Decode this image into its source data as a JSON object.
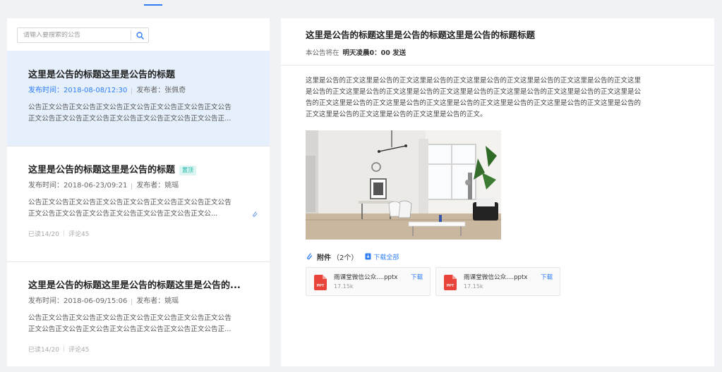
{
  "search": {
    "placeholder": "请输入要搜索的公告"
  },
  "list": [
    {
      "title": "这里是公告的标题这里是公告的标题",
      "date": "发布时间：2018-08-08/12:30",
      "author": "发布者：张佩奇",
      "body": [
        "公告正文公告正文公告正文公告正文公告正文公告正文公告正文公告",
        "正文公告正文公告正文公告正文公告正文公告正文公告正文公告正..."
      ],
      "status": "unread-selected"
    },
    {
      "title": "这里是公告的标题这里是公告的标题",
      "badge": "置顶",
      "date": "发布时间：2018-06-23/09:21",
      "author": "发布者：姚瑶",
      "body": [
        "公告正文公告正文公告正文公告正文公告正文公告正文公告正文公告",
        "正文公告正文公告正文公告正文公告正文公告正文公告正文公..."
      ],
      "read": "已读14/20",
      "comments": "评论45",
      "status": "unread"
    },
    {
      "title": "这里是公告的标题这里是公告的标题这里是公告的...",
      "date": "发布时间：2018-06-09/15:06",
      "author": "发布者：姚瑶",
      "body": [
        "公告正文公告正文公告正文公告正文公告正文公告正文公告正文公告",
        "正文公告正文公告正文公告正文公告正文公告正文公告正文公告正..."
      ],
      "read": "已读14/20",
      "comments": "评论45",
      "status": "unread"
    }
  ],
  "detail": {
    "title": "这里是公告的标题这里是公告的标题这里是公告的标题标题",
    "schedule_prefix": "本公告将在",
    "schedule_time": "明天凌晨0：00 发送",
    "body_lines": [
      "这里是公告的正文这里是公告的正文这里是公告的正文这里是公告的正文这里是公告的正文这里是公告的正文这里",
      "是公告的正文这里是公告的正文这里是公告的正文这里是公告的正文这里是公告的正文这里是公告的正文这里是公",
      "告的正文这里是公告的正文这里是公告的正文这里是公告的正文这里是公告的正文这里是公告的正文这里是公告的",
      "正文这里是公告的正文这里是公告的正文这里是公告的正文。"
    ],
    "attachments_label": "附件",
    "attachments_count": "（2个）",
    "download_all": "下载全部",
    "files": [
      {
        "name": "雨课堂微信公众....pptx",
        "size": "17.15k",
        "action": "下载",
        "type_label": "PPT"
      },
      {
        "name": "雨课堂微信公众....pptx",
        "size": "17.15k",
        "action": "下载",
        "type_label": "PPT"
      }
    ]
  },
  "colors": {
    "accent": "#2f7cf6",
    "unread_dot": "#e0302a",
    "selected_bg": "#e6f0fc",
    "badge": "#1bb5a8"
  }
}
